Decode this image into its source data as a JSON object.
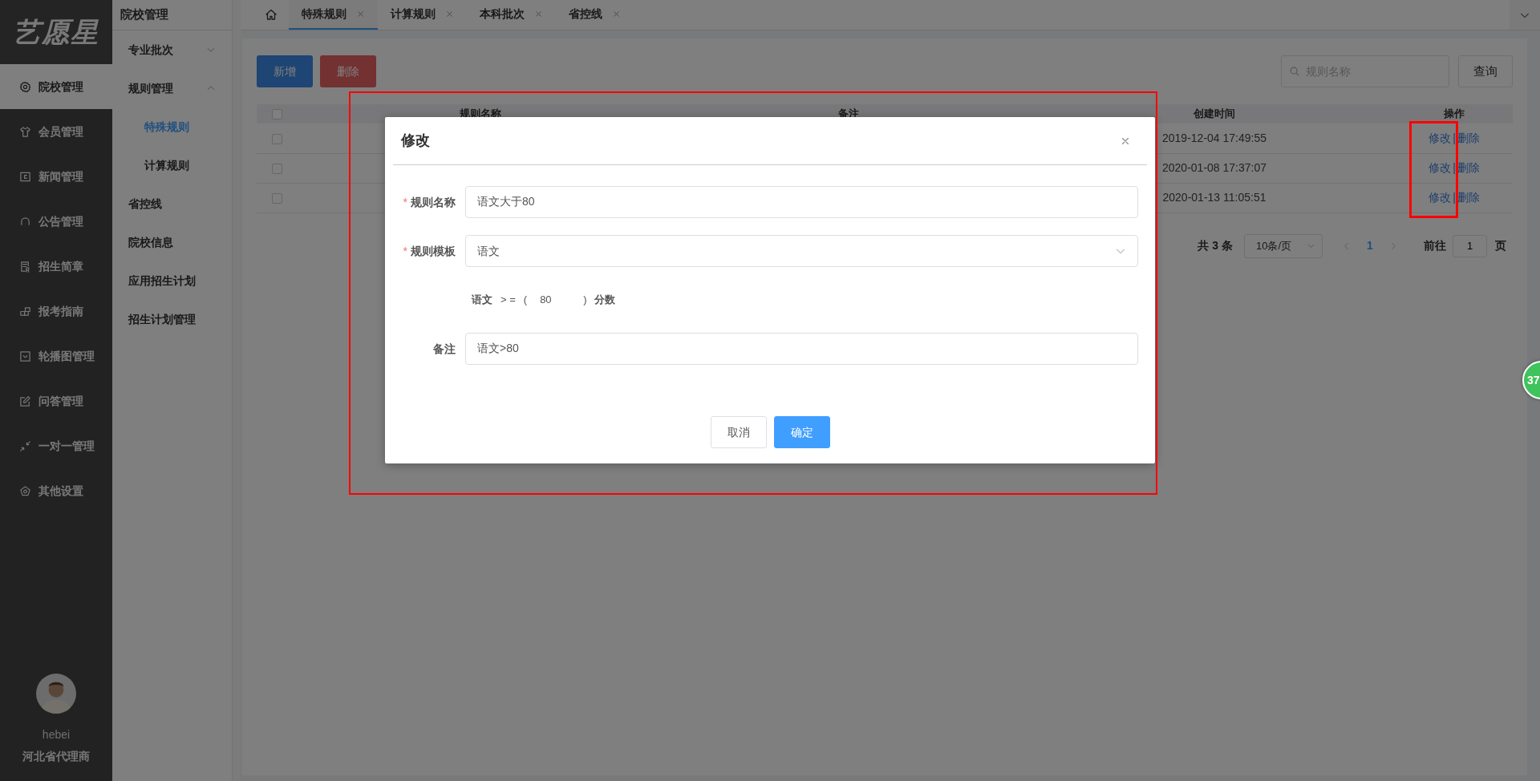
{
  "logo": {
    "text": "艺愿星"
  },
  "main_menu": [
    {
      "label": "院校管理",
      "selected": true
    },
    {
      "label": "会员管理",
      "selected": false
    },
    {
      "label": "新闻管理",
      "selected": false
    },
    {
      "label": "公告管理",
      "selected": false
    },
    {
      "label": "招生简章",
      "selected": false
    },
    {
      "label": "报考指南",
      "selected": false
    },
    {
      "label": "轮播图管理",
      "selected": false
    },
    {
      "label": "问答管理",
      "selected": false
    },
    {
      "label": "一对一管理",
      "selected": false
    },
    {
      "label": "其他设置",
      "selected": false
    }
  ],
  "user": {
    "name": "hebei",
    "role": "河北省代理商"
  },
  "sub_menu": {
    "title": "院校管理",
    "items": [
      {
        "label": "专业批次",
        "kind": "group",
        "expanded": false,
        "selected": false
      },
      {
        "label": "规则管理",
        "kind": "group",
        "expanded": true,
        "selected": false,
        "children": [
          {
            "label": "特殊规则",
            "selected": true
          },
          {
            "label": "计算规则",
            "selected": false
          }
        ]
      },
      {
        "label": "省控线",
        "kind": "link",
        "selected": false
      },
      {
        "label": "院校信息",
        "kind": "link",
        "selected": false
      },
      {
        "label": "应用招生计划",
        "kind": "link",
        "selected": false
      },
      {
        "label": "招生计划管理",
        "kind": "link",
        "selected": false
      }
    ]
  },
  "tabs": [
    {
      "kind": "home"
    },
    {
      "kind": "page",
      "label": "特殊规则",
      "selected": true
    },
    {
      "kind": "page",
      "label": "计算规则",
      "selected": false
    },
    {
      "kind": "page",
      "label": "本科批次",
      "selected": false
    },
    {
      "kind": "page",
      "label": "省控线",
      "selected": false
    }
  ],
  "toolbar": {
    "buttons": [
      {
        "label": "新增",
        "kind": "primary"
      },
      {
        "label": "删除",
        "kind": "danger"
      }
    ],
    "search": {
      "placeholder": "规则名称"
    },
    "query_button": "查询"
  },
  "table": {
    "select_all_checked": false,
    "columns": [
      "规则名称",
      "备注",
      "创建时间",
      "操作"
    ],
    "rows": [
      {
        "checked": false,
        "created": "2019-12-04 17:49:55",
        "actions": [
          "修改",
          "|",
          "删除"
        ]
      },
      {
        "checked": false,
        "created": "2020-01-08 17:37:07",
        "actions": [
          "修改",
          "|",
          "删除"
        ]
      },
      {
        "checked": false,
        "created": "2020-01-13 11:05:51",
        "actions": [
          "修改",
          "|",
          "删除"
        ]
      }
    ]
  },
  "pagination": {
    "total": "共 3 条",
    "page_size": "10条/页",
    "pages": [
      {
        "label": "1",
        "selected": true
      }
    ],
    "goto_label": "前往",
    "goto_value": "1",
    "page_suffix": "页"
  },
  "dialog": {
    "title": "修改",
    "fields": [
      {
        "kind": "input",
        "label": "规则名称",
        "required_mark": "*",
        "value": "语文大于80"
      },
      {
        "kind": "select",
        "label": "规则模板",
        "required_mark": "*",
        "value": "语文"
      },
      {
        "kind": "formula",
        "subject": "语文",
        "operator": "> =",
        "open": "(",
        "value": "80",
        "close": ")",
        "unit": "分数"
      },
      {
        "kind": "input",
        "label": "备注",
        "value": "语文>80"
      }
    ],
    "buttons": [
      {
        "label": "取消",
        "kind": "default"
      },
      {
        "label": "确定",
        "kind": "primary"
      }
    ]
  },
  "floating_badge": {
    "text": "37"
  },
  "highlight_frames": [
    {
      "kind": "dialog"
    },
    {
      "kind": "actions"
    }
  ]
}
